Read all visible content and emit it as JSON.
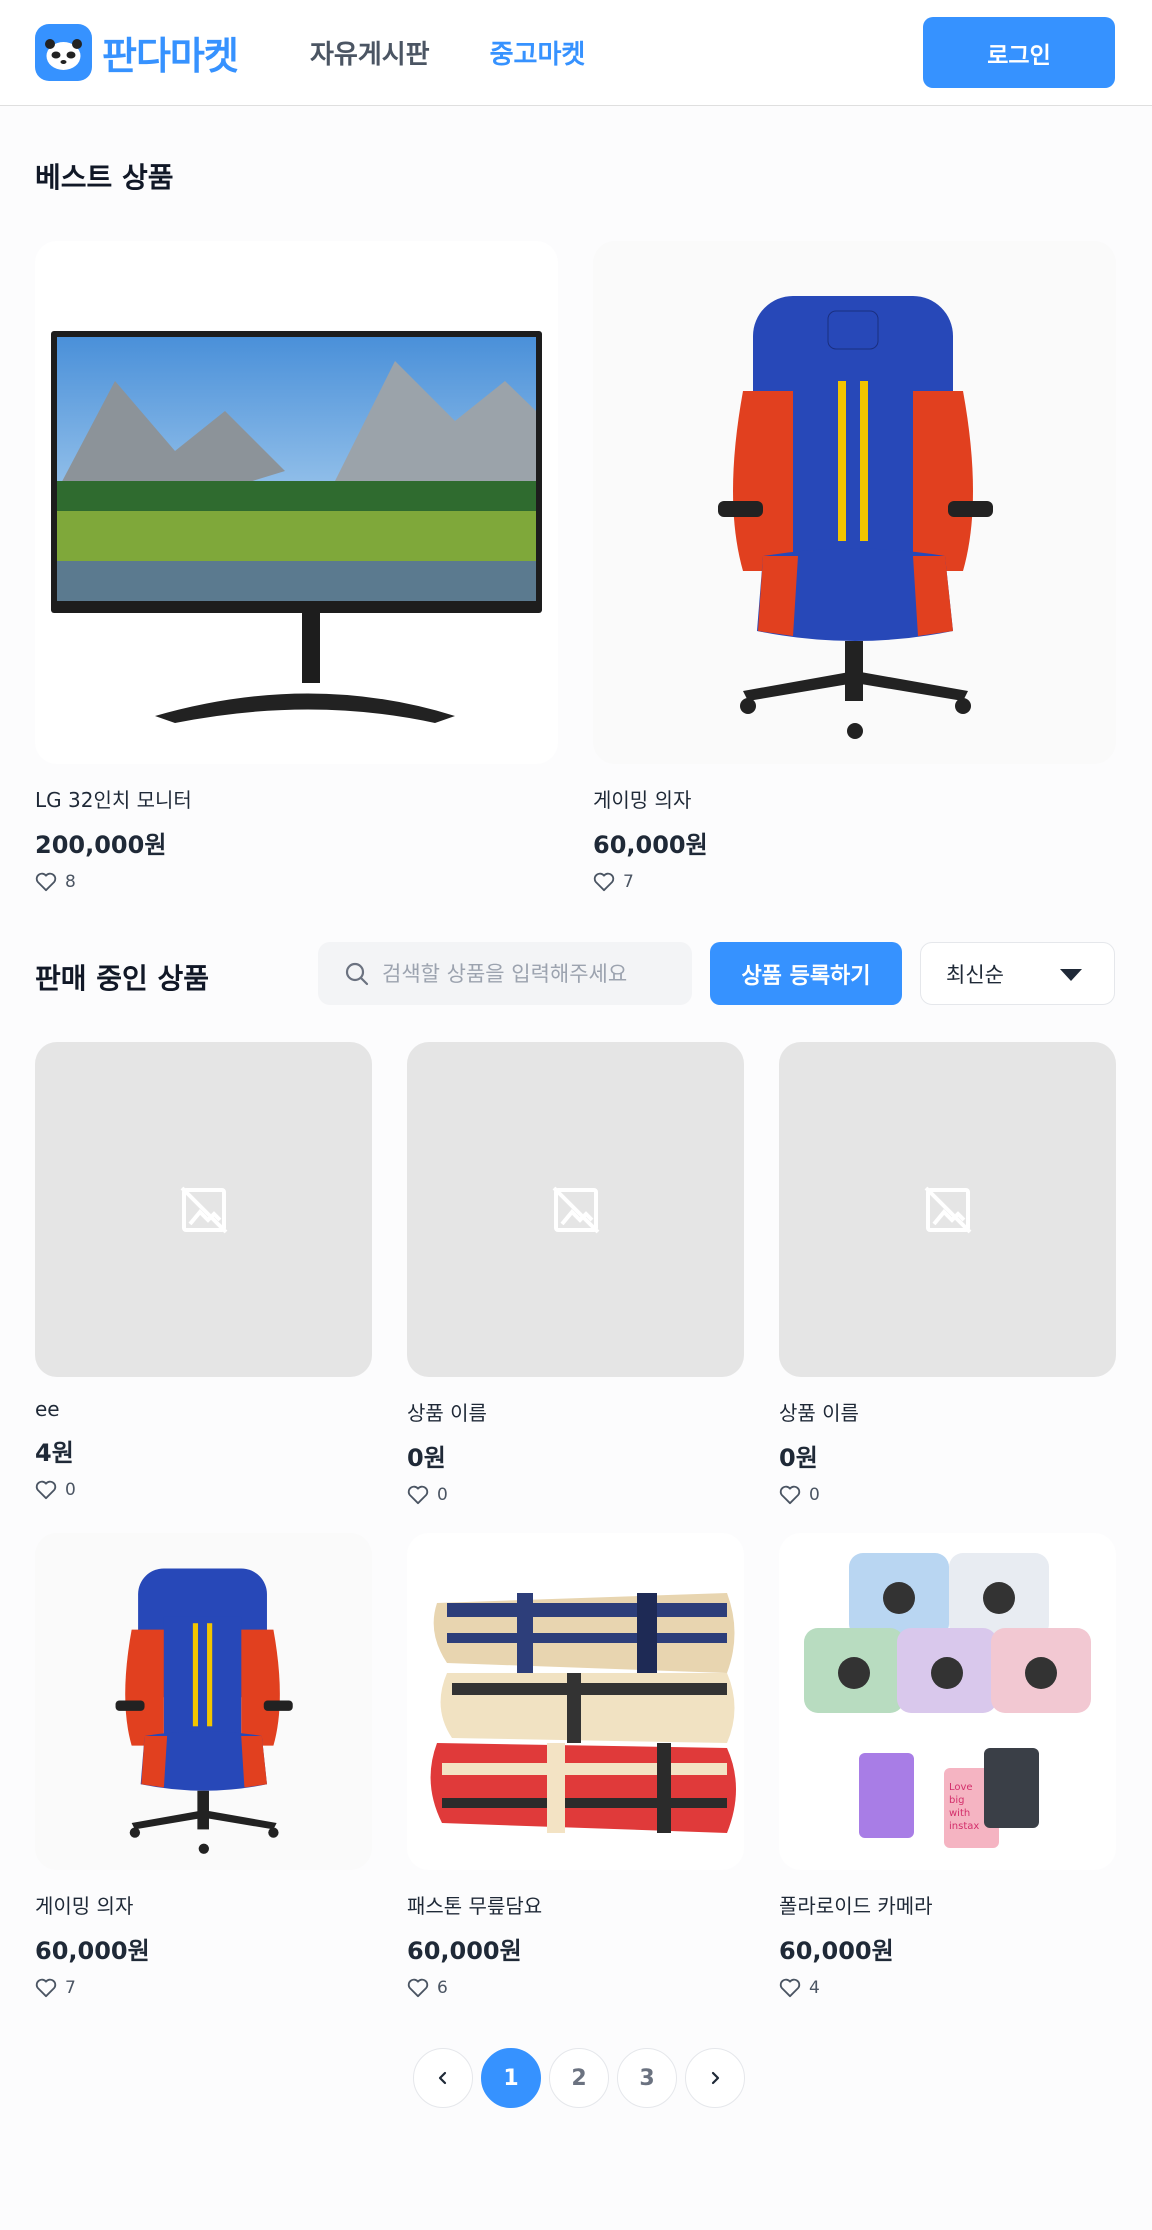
{
  "header": {
    "logo_text": "판다마켓",
    "nav": [
      {
        "label": "자유게시판",
        "active": false
      },
      {
        "label": "중고마켓",
        "active": true
      }
    ],
    "login_label": "로그인"
  },
  "best": {
    "title": "베스트 상품",
    "items": [
      {
        "name": "LG 32인치 모니터",
        "price": "200,000원",
        "likes": "8",
        "image": "monitor-image"
      },
      {
        "name": "게이밍 의자",
        "price": "60,000원",
        "likes": "7",
        "image": "gaming-chair-image"
      }
    ]
  },
  "sale": {
    "title": "판매 중인 상품",
    "search_placeholder": "검색할 상품을 입력해주세요",
    "register_label": "상품 등록하기",
    "sort_selected": "최신순",
    "items": [
      {
        "name": "ee",
        "price": "4원",
        "likes": "0",
        "image": "no-image-placeholder"
      },
      {
        "name": "상품 이름",
        "price": "0원",
        "likes": "0",
        "image": "no-image-placeholder"
      },
      {
        "name": "상품 이름",
        "price": "0원",
        "likes": "0",
        "image": "no-image-placeholder"
      },
      {
        "name": "게이밍 의자",
        "price": "60,000원",
        "likes": "7",
        "image": "gaming-chair-image"
      },
      {
        "name": "패스톤 무릎담요",
        "price": "60,000원",
        "likes": "6",
        "image": "blanket-image"
      },
      {
        "name": "폴라로이드 카메라",
        "price": "60,000원",
        "likes": "4",
        "image": "instant-camera-image"
      }
    ]
  },
  "pagination": {
    "prev_icon": "chevron-left-icon",
    "pages": [
      "1",
      "2",
      "3"
    ],
    "current": "1",
    "next_icon": "chevron-right-icon"
  },
  "colors": {
    "accent": "#3692ff",
    "placeholder_bg": "#e5e5e5"
  }
}
